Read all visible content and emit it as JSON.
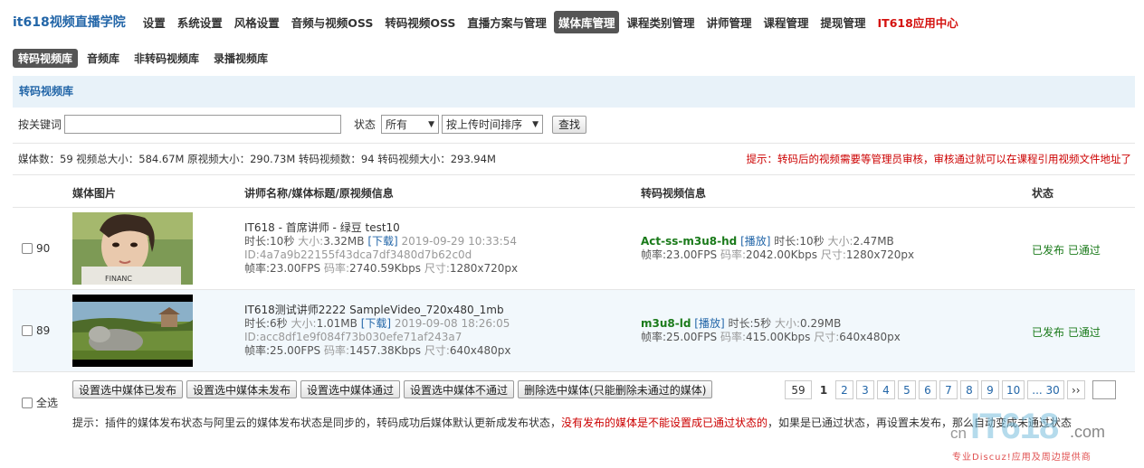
{
  "brand": "it618视频直播学院",
  "nav": [
    {
      "label": "设置"
    },
    {
      "label": "系统设置"
    },
    {
      "label": "风格设置"
    },
    {
      "label": "音频与视频OSS"
    },
    {
      "label": "转码视频OSS"
    },
    {
      "label": "直播方案与管理"
    },
    {
      "label": "媒体库管理"
    },
    {
      "label": "课程类别管理"
    },
    {
      "label": "讲师管理"
    },
    {
      "label": "课程管理"
    },
    {
      "label": "提现管理"
    },
    {
      "label": "IT618应用中心"
    }
  ],
  "subnav": [
    {
      "label": "转码视频库"
    },
    {
      "label": "音频库"
    },
    {
      "label": "非转码视频库"
    },
    {
      "label": "录播视频库"
    }
  ],
  "section_title": "转码视频库",
  "filter": {
    "keyword_label": "按关键词",
    "keyword_value": "",
    "status_label": "状态",
    "status_value": "所有",
    "sort_value": "按上传时间排序",
    "search_label": "查找"
  },
  "stats": "媒体数：59 视频总大小：584.67M 原视频大小：290.73M 转码视频数：94 转码视频大小：293.94M",
  "notice": "提示：转码后的视频需要等管理员审核，审核通过就可以在课程引用视频文件地址了",
  "columns": {
    "image": "媒体图片",
    "info": "讲师名称/媒体标题/原视频信息",
    "transcode": "转码视频信息",
    "status": "状态"
  },
  "rows": [
    {
      "id": "90",
      "title": "IT618 - 首席讲师 - 绿豆 test10",
      "duration_label": "时长:",
      "duration": "10秒",
      "size_label": "大小:",
      "size": "3.32MB",
      "download": "[下载]",
      "date": "2019-09-29 10:33:54",
      "media_id": "ID:4a7a9b22155f43dca7df3480d7b62c0d",
      "fps_label": "帧率:",
      "fps": "23.00FPS",
      "bitrate_label": "码率:",
      "bitrate": "2740.59Kbps",
      "dim_label": "尺寸:",
      "dim": "1280x720px",
      "t_name": "Act-ss-m3u8-hd",
      "t_play": "[播放]",
      "t_duration": "10秒",
      "t_size": "2.47MB",
      "t_fps": "23.00FPS",
      "t_bitrate": "2042.00Kbps",
      "t_dim": "1280x720px",
      "status": "已发布 已通过"
    },
    {
      "id": "89",
      "title": "IT618测试讲师2222 SampleVideo_720x480_1mb",
      "duration_label": "时长:",
      "duration": "6秒",
      "size_label": "大小:",
      "size": "1.01MB",
      "download": "[下载]",
      "date": "2019-09-08 18:26:05",
      "media_id": "ID:acc8df1e9f084f73b030efe71af243a7",
      "fps_label": "帧率:",
      "fps": "25.00FPS",
      "bitrate_label": "码率:",
      "bitrate": "1457.38Kbps",
      "dim_label": "尺寸:",
      "dim": "640x480px",
      "t_name": "m3u8-ld",
      "t_play": "[播放]",
      "t_duration": "5秒",
      "t_size": "0.29MB",
      "t_fps": "25.00FPS",
      "t_bitrate": "415.00Kbps",
      "t_dim": "640x480px",
      "status": "已发布 已通过"
    }
  ],
  "t_labels": {
    "duration": "时长:",
    "size": "大小:",
    "fps": "帧率:",
    "bitrate": "码率:",
    "dim": "尺寸:"
  },
  "select_all": "全选",
  "actions": [
    {
      "label": "设置选中媒体已发布"
    },
    {
      "label": "设置选中媒体未发布"
    },
    {
      "label": "设置选中媒体通过"
    },
    {
      "label": "设置选中媒体不通过"
    },
    {
      "label": "删除选中媒体(只能删除未通过的媒体)"
    }
  ],
  "pager": {
    "total": "59",
    "current": "1",
    "pages": [
      "2",
      "3",
      "4",
      "5",
      "6",
      "7",
      "8",
      "9",
      "10"
    ],
    "last": "... 30",
    "next": "››"
  },
  "tip": {
    "part1": "提示：插件的媒体发布状态与阿里云的媒体发布状态是同步的，转码成功后媒体默认更新成发布状态，",
    "part2": "没有发布的媒体是不能设置成已通过状态的",
    "part3": "，如果是已通过状态，再设置未发布，那么自动变成未通过状态"
  },
  "watermark": {
    "cn": "cn",
    "brand": "IT618",
    "com": ".com",
    "slogan": "专业Discuz!应用及周边提供商"
  }
}
